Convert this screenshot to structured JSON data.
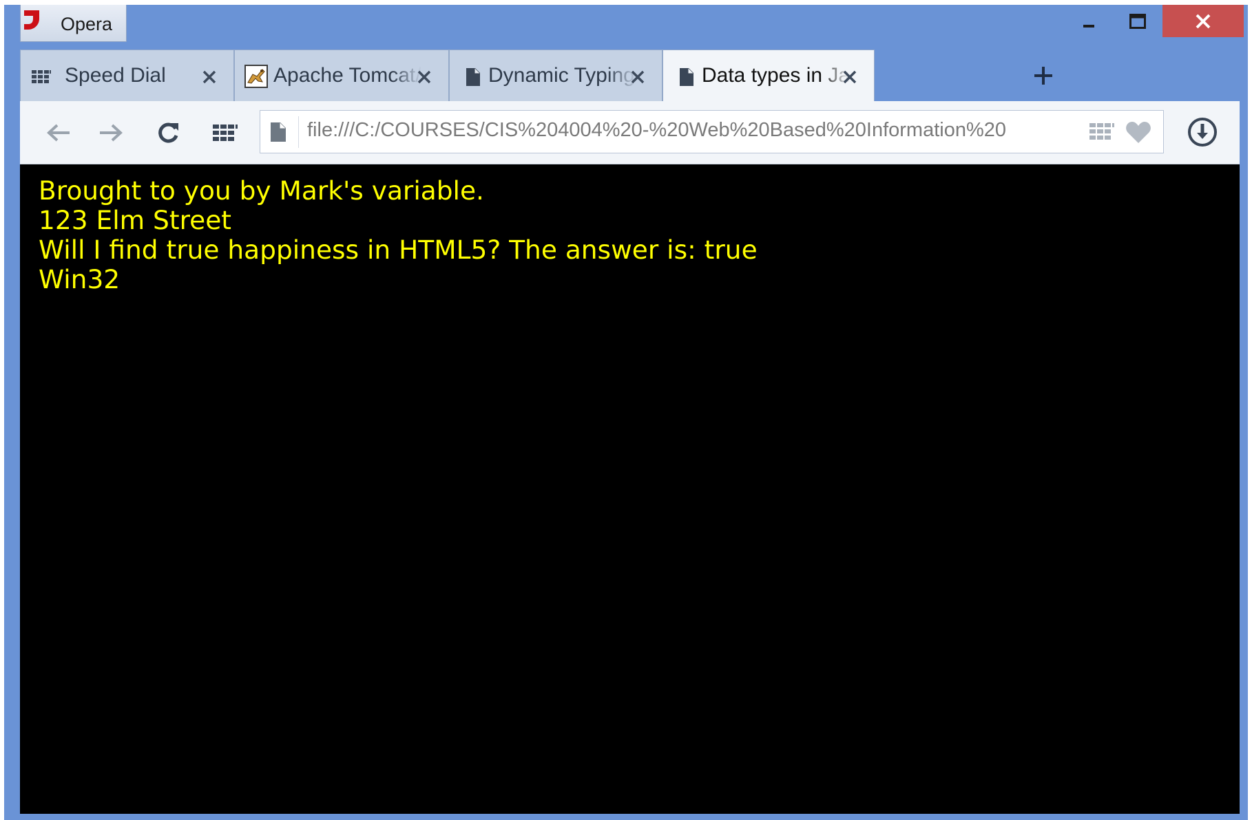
{
  "window": {
    "app_button_label": "Opera"
  },
  "tabs": [
    {
      "label": "Speed Dial",
      "icon": "speed-dial-grid-icon",
      "active": false
    },
    {
      "label": "Apache Tomcat/",
      "icon": "tomcat-icon",
      "active": false
    },
    {
      "label": "Dynamic Typing",
      "icon": "page-icon",
      "active": false
    },
    {
      "label": "Data types in Jav",
      "icon": "page-icon",
      "active": true
    }
  ],
  "toolbar": {
    "address": "file:///C:/COURSES/CIS%204004%20-%20Web%20Based%20Information%20"
  },
  "page": {
    "lines": [
      "Brought to you by Mark's variable.",
      "123 Elm Street",
      "Will I find true happiness in HTML5? The answer is: true",
      "Win32"
    ],
    "text_color": "#ffff00",
    "background": "#000000"
  },
  "colors": {
    "frame": "#6a93d6",
    "close_button": "#c75050",
    "tab_inactive": "#c5d2e4",
    "tab_active": "#f2f5f9"
  }
}
